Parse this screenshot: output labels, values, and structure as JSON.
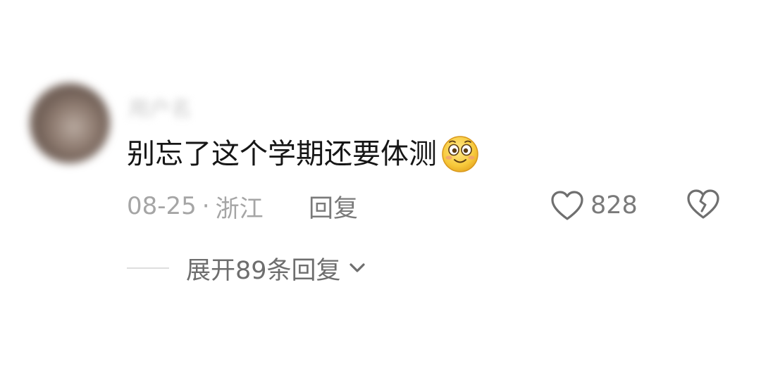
{
  "comment": {
    "username": "用户名",
    "text": "别忘了这个学期还要体测",
    "emoji_icon": "smiley-blush-emoji",
    "date": "08-25",
    "separator": "·",
    "location": "浙江",
    "reply_label": "回复",
    "like_count": "828",
    "expand_label": "展开89条回复"
  },
  "colors": {
    "text": "#161616",
    "meta": "#a5a5a5",
    "action": "#7a7a7a",
    "expand_line": "#dedede"
  }
}
